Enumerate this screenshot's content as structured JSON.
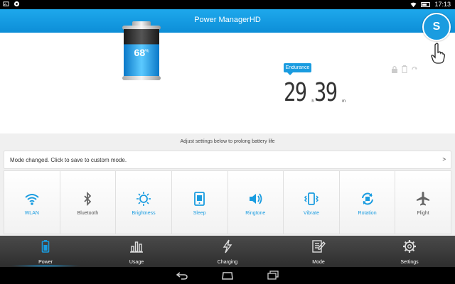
{
  "status_bar": {
    "time": "17:13"
  },
  "title_bar": {
    "title": "Power ManagerHD",
    "s_button": "S"
  },
  "battery": {
    "percent": "68",
    "percent_unit": "%",
    "level": 0.68
  },
  "endurance": {
    "badge": "Endurance",
    "hours": "29",
    "hours_unit": "h",
    "minutes": "39",
    "minutes_unit": "m"
  },
  "hint": "Adjust settings below to prolong battery life",
  "mode_bar": {
    "text": "Mode changed. Click to save to custom mode.",
    "arrow": ">"
  },
  "toggles": [
    {
      "label": "WLAN",
      "icon": "wifi-icon",
      "active": true
    },
    {
      "label": "Bluetooth",
      "icon": "bluetooth-icon",
      "active": false
    },
    {
      "label": "Brightness",
      "icon": "brightness-icon",
      "active": true
    },
    {
      "label": "Sleep",
      "icon": "sleep-icon",
      "active": true
    },
    {
      "label": "Ringtone",
      "icon": "ringtone-icon",
      "active": true
    },
    {
      "label": "Vibrate",
      "icon": "vibrate-icon",
      "active": true
    },
    {
      "label": "Rotation",
      "icon": "rotation-icon",
      "active": true
    },
    {
      "label": "Flight",
      "icon": "airplane-icon",
      "active": false
    }
  ],
  "tabs": [
    {
      "label": "Power",
      "icon": "battery-icon",
      "active": true
    },
    {
      "label": "Usage",
      "icon": "bar-chart-icon",
      "active": false
    },
    {
      "label": "Charging",
      "icon": "lightning-icon",
      "active": false
    },
    {
      "label": "Mode",
      "icon": "edit-note-icon",
      "active": false
    },
    {
      "label": "Settings",
      "icon": "gear-icon",
      "active": false
    }
  ],
  "colors": {
    "accent": "#1a9ce0",
    "title_bar": "#1ea8ec",
    "tab_bar": "#3a3a3a"
  }
}
